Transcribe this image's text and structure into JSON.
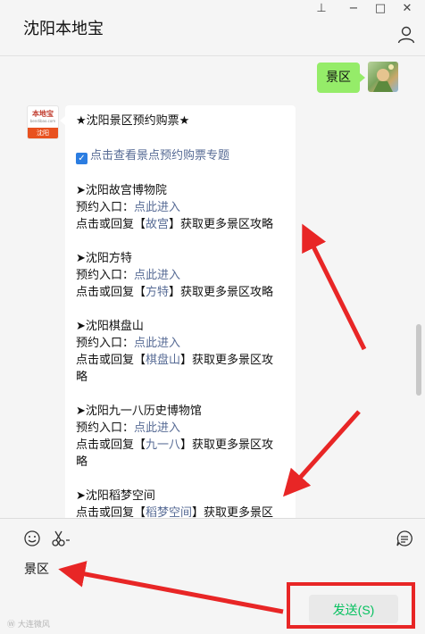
{
  "window": {
    "title": "沈阳本地宝",
    "controls": {
      "pin": "⊥",
      "minimize": "−",
      "maximize": "□",
      "close": "✕"
    }
  },
  "my_message": {
    "text": "景区"
  },
  "account_logo": {
    "top": "本地宝",
    "sub": "bendibao.com",
    "bottom": "沈阳"
  },
  "reply": {
    "header": "★沈阳景区预约购票★",
    "topic_link": "点击查看景点预约购票专题",
    "spots": [
      {
        "name": "➤沈阳故宫博物院",
        "entry_label": "预约入口：",
        "entry_link": "点此进入",
        "reply_prefix": "点击或回复【",
        "keyword": "故宫",
        "reply_suffix": "】获取更多景区攻略",
        "reply_suffix_cont": ""
      },
      {
        "name": "➤沈阳方特",
        "entry_label": "预约入口：",
        "entry_link": "点此进入",
        "reply_prefix": "点击或回复【",
        "keyword": "方特",
        "reply_suffix": "】获取更多景区攻略",
        "reply_suffix_cont": ""
      },
      {
        "name": "➤沈阳棋盘山",
        "entry_label": "预约入口：",
        "entry_link": "点此进入",
        "reply_prefix": "点击或回复【",
        "keyword": "棋盘山",
        "reply_suffix": "】获取更多景区攻",
        "reply_suffix_cont": "略"
      },
      {
        "name": "➤沈阳九一八历史博物馆",
        "entry_label": "预约入口：",
        "entry_link": "点此进入",
        "reply_prefix": "点击或回复【",
        "keyword": "九一八",
        "reply_suffix": "】获取更多景区攻",
        "reply_suffix_cont": "略"
      },
      {
        "name": "➤沈阳稻梦空间",
        "reply_prefix": "点击或回复【",
        "keyword": "稻梦空间",
        "reply_suffix": "】获取更多景区"
      }
    ]
  },
  "input": {
    "value": "景区"
  },
  "toolbar": {
    "emoji_icon": "smiley-icon",
    "screenshot_icon": "scissors-icon",
    "history_icon": "chat-history-icon"
  },
  "send_button": {
    "label": "发送(S)"
  },
  "watermark": "Ⓦ 大连微风",
  "colors": {
    "accent_green": "#07c160",
    "bubble_green": "#95ec69",
    "link": "#576b95",
    "annotation_red": "#e82626"
  }
}
